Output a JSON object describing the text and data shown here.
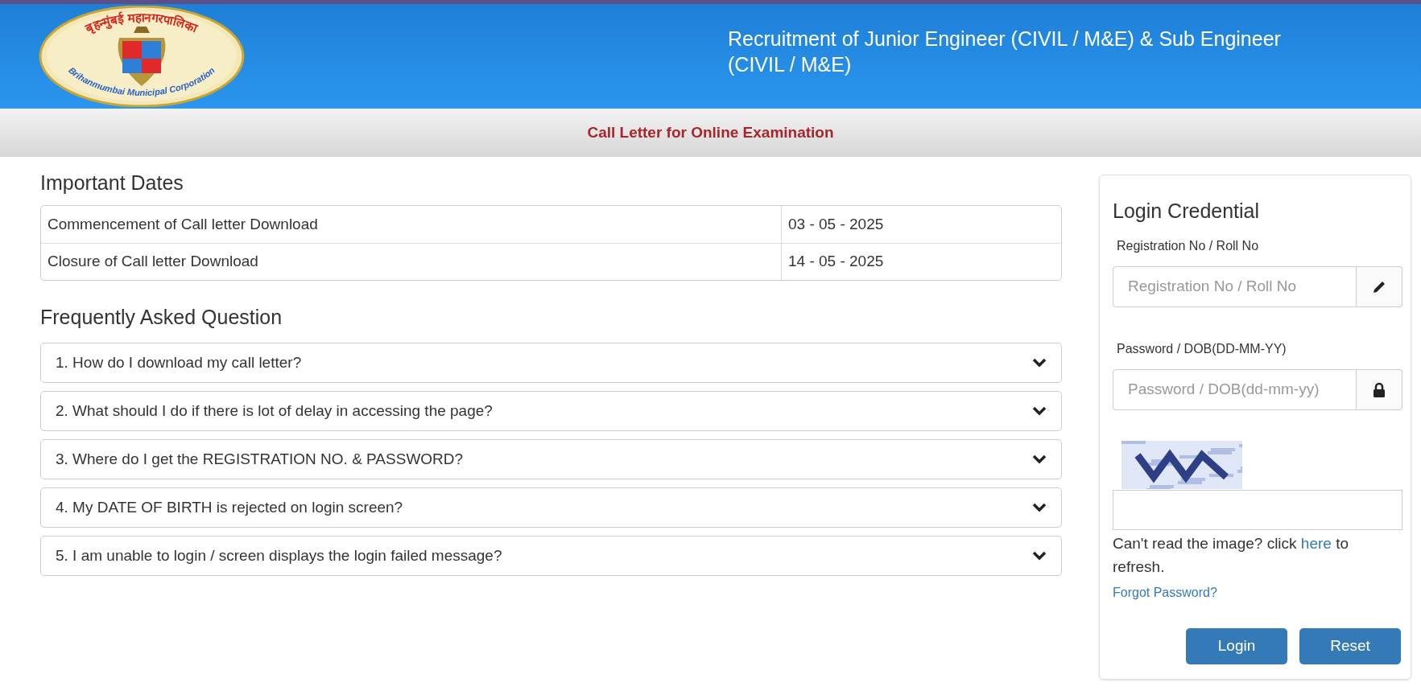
{
  "header": {
    "logo_top_text": "बृहन्मुंबई महानगरपालिका",
    "logo_bottom_text": "Brihanmumbai Municipal Corporation",
    "title": "Recruitment of Junior Engineer (CIVIL / M&E) & Sub Engineer (CIVIL / M&E)"
  },
  "subheader": "Call Letter for Online Examination",
  "important_dates": {
    "title": "Important Dates",
    "rows": [
      {
        "event": "Commencement of Call letter Download",
        "date": "03 - 05 - 2025"
      },
      {
        "event": "Closure of Call letter Download",
        "date": "14 - 05 - 2025"
      }
    ]
  },
  "faq": {
    "title": "Frequently Asked Question",
    "items": [
      {
        "question": "1. How do I download my call letter?",
        "expanded": false
      },
      {
        "question": "2. What should I do if there is lot of delay in accessing the page?",
        "expanded": false
      },
      {
        "question": "3. Where do I get the REGISTRATION NO. & PASSWORD?",
        "expanded": false
      },
      {
        "question": "4. My DATE OF BIRTH is rejected on login screen?",
        "expanded": false
      },
      {
        "question": "5. I am unable to login / screen displays the login failed message?",
        "expanded": false
      }
    ]
  },
  "login": {
    "title": "Login Credential",
    "fields": [
      {
        "label": "Registration No / Roll No",
        "placeholder": "Registration No / Roll No",
        "kind": "text"
      },
      {
        "label": "Password / DOB(DD-MM-YY)",
        "placeholder": "Password / DOB(dd-mm-yy)",
        "kind": "password"
      }
    ],
    "refresh_text_before": "Can't read the image? click",
    "refresh_link": "here",
    "refresh_text_after": "to refresh.",
    "forgot_link": "Forgot Password?",
    "buttons": [
      "Login",
      "Reset"
    ]
  }
}
